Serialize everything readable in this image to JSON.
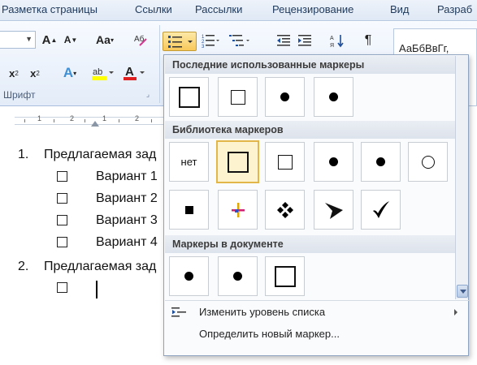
{
  "ribbon": {
    "tabs": [
      "Разметка страницы",
      "Ссылки",
      "Рассылки",
      "Рецензирование",
      "Вид",
      "Разраб"
    ],
    "font_group_label": "Шрифт",
    "style_preview": "АаБбВвГг,"
  },
  "document": {
    "items": [
      {
        "number": "1.",
        "text": "Предлагаемая зад",
        "subitems": [
          "Вариант 1",
          "Вариант 2",
          "Вариант 3",
          "Вариант 4"
        ]
      },
      {
        "number": "2.",
        "text": "Предлагаемая зад",
        "subitems": [
          ""
        ]
      }
    ]
  },
  "bullet_menu": {
    "recent_header": "Последние использованные маркеры",
    "recent_markers": [
      "square-large-icon",
      "square-small-icon",
      "dot-icon",
      "dot-icon"
    ],
    "library_header": "Библиотека маркеров",
    "library_none_label": "нет",
    "library_markers": [
      "square-large-icon",
      "square-small-icon",
      "dot-icon",
      "dot-icon",
      "circle-icon",
      "filled-square-icon",
      "colored-cross-icon",
      "diamond-cluster-icon",
      "arrowhead-icon",
      "checkmark-icon"
    ],
    "document_header": "Маркеры в документе",
    "document_markers": [
      "dot-icon",
      "dot-icon",
      "square-large-icon"
    ],
    "change_level": "Изменить уровень списка",
    "define_new": "Определить новый маркер..."
  },
  "colors": {
    "selected_border": "#e3b64a",
    "selected_fill": "#fdf3cf",
    "ribbon_tab_text": "#1e395b"
  }
}
